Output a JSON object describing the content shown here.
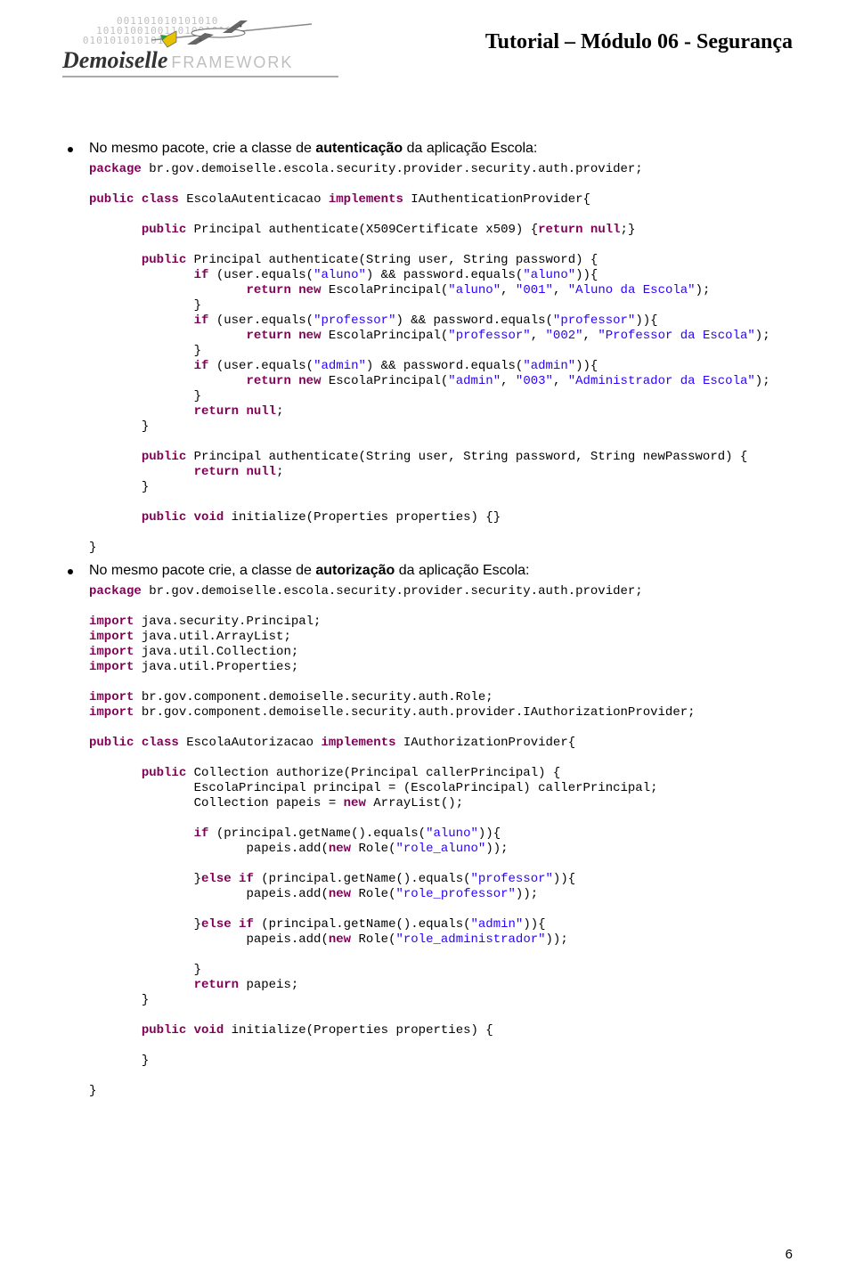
{
  "header": {
    "binary": "        001101010101010\n     10101001001101001010\n   0101010101010",
    "brand_italic": "Demoiselle",
    "brand_framework": "FRAMEWORK",
    "title": "Tutorial – Módulo 06 - Segurança"
  },
  "body": {
    "bullet1_pre": "No mesmo pacote, crie a classe de ",
    "bullet1_bold": "autenticação",
    "bullet1_post": " da aplicação Escola:",
    "bullet2_pre": "No mesmo pacote crie, a classe de ",
    "bullet2_bold": "autorização",
    "bullet2_post": " da aplicação Escola:"
  },
  "code1": {
    "l1a": "package",
    "l1b": " br.gov.demoiselle.escola.security.provider.security.auth.provider;",
    "l2a": "public",
    "l2b": " class",
    "l2c": " EscolaAutenticacao ",
    "l2d": "implements",
    "l2e": " IAuthenticationProvider{",
    "l3a": "       public",
    "l3b": " Principal authenticate(X509Certificate x509) {",
    "l3c": "return",
    "l3d": " null",
    "l3e": ";}",
    "l4a": "       public",
    "l4b": " Principal authenticate(String user, String password) {",
    "l5a": "              if",
    "l5b": " (user.equals(",
    "l5c": "\"aluno\"",
    "l5d": ") && password.equals(",
    "l5e": "\"aluno\"",
    "l5f": ")){",
    "l6a": "                     return",
    "l6b": " new",
    "l6c": " EscolaPrincipal(",
    "l6d": "\"aluno\"",
    "l6e": ", ",
    "l6f": "\"001\"",
    "l6g": ", ",
    "l6h": "\"Aluno da Escola\"",
    "l6i": ");",
    "l7": "              }",
    "l8a": "              if",
    "l8b": " (user.equals(",
    "l8c": "\"professor\"",
    "l8d": ") && password.equals(",
    "l8e": "\"professor\"",
    "l8f": ")){",
    "l9a": "                     return",
    "l9b": " new",
    "l9c": " EscolaPrincipal(",
    "l9d": "\"professor\"",
    "l9e": ", ",
    "l9f": "\"002\"",
    "l9g": ", ",
    "l9h": "\"Professor da Escola\"",
    "l9i": ");",
    "l10": "              }",
    "l11a": "              if",
    "l11b": " (user.equals(",
    "l11c": "\"admin\"",
    "l11d": ") && password.equals(",
    "l11e": "\"admin\"",
    "l11f": ")){",
    "l12a": "                     return",
    "l12b": " new",
    "l12c": " EscolaPrincipal(",
    "l12d": "\"admin\"",
    "l12e": ", ",
    "l12f": "\"003\"",
    "l12g": ", ",
    "l12h": "\"Administrador da Escola\"",
    "l12i": ");",
    "l13": "              }",
    "l14a": "              return",
    "l14b": " null",
    "l14c": ";",
    "l15": "       }",
    "l16a": "       public",
    "l16b": " Principal authenticate(String user, String password, String newPassword) {",
    "l17a": "              return",
    "l17b": " null",
    "l17c": ";",
    "l18": "       }",
    "l19a": "       public",
    "l19b": " void",
    "l19c": " initialize(Properties properties) {}",
    "l20": "}"
  },
  "code2": {
    "l1a": "package",
    "l1b": " br.gov.demoiselle.escola.security.provider.security.auth.provider;",
    "l2a": "import",
    "l2b": " java.security.Principal;",
    "l3a": "import",
    "l3b": " java.util.ArrayList;",
    "l4a": "import",
    "l4b": " java.util.Collection;",
    "l5a": "import",
    "l5b": " java.util.Properties;",
    "l6a": "import",
    "l6b": " br.gov.component.demoiselle.security.auth.Role;",
    "l7a": "import",
    "l7b": " br.gov.component.demoiselle.security.auth.provider.IAuthorizationProvider;",
    "l8a": "public",
    "l8b": " class",
    "l8c": " EscolaAutorizacao ",
    "l8d": "implements",
    "l8e": " IAuthorizationProvider{",
    "l9a": "       public",
    "l9b": " Collection authorize(Principal callerPrincipal) {",
    "l10": "              EscolaPrincipal principal = (EscolaPrincipal) callerPrincipal;",
    "l11a": "              Collection papeis = ",
    "l11b": "new",
    "l11c": " ArrayList();",
    "l12a": "              if",
    "l12b": " (principal.getName().equals(",
    "l12c": "\"aluno\"",
    "l12d": ")){",
    "l13a": "                     papeis.add(",
    "l13b": "new",
    "l13c": " Role(",
    "l13d": "\"role_aluno\"",
    "l13e": "));",
    "l14a": "              }",
    "l14b": "else",
    "l14c": " if",
    "l14d": " (principal.getName().equals(",
    "l14e": "\"professor\"",
    "l14f": ")){",
    "l15a": "                     papeis.add(",
    "l15b": "new",
    "l15c": " Role(",
    "l15d": "\"role_professor\"",
    "l15e": "));",
    "l16a": "              }",
    "l16b": "else",
    "l16c": " if",
    "l16d": " (principal.getName().equals(",
    "l16e": "\"admin\"",
    "l16f": ")){",
    "l17a": "                     papeis.add(",
    "l17b": "new",
    "l17c": " Role(",
    "l17d": "\"role_administrador\"",
    "l17e": "));",
    "l18": "              }",
    "l19a": "              return",
    "l19b": " papeis;",
    "l20": "       }",
    "l21a": "       public",
    "l21b": " void",
    "l21c": " initialize(Properties properties) {",
    "l22": "       }",
    "l23": "}"
  },
  "page_number": "6"
}
